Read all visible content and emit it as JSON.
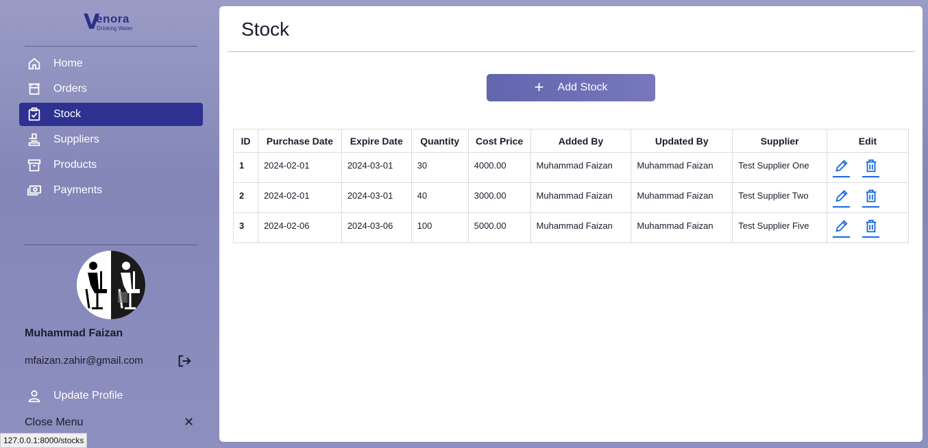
{
  "brand": {
    "logo_letter": "V",
    "logo_word": "enora",
    "logo_sub": "Drinking Water"
  },
  "sidebar": {
    "items": [
      {
        "label": "Home",
        "icon": "home-icon"
      },
      {
        "label": "Orders",
        "icon": "cart-icon"
      },
      {
        "label": "Stock",
        "icon": "clipboard-check-icon",
        "active": true
      },
      {
        "label": "Suppliers",
        "icon": "supplier-icon"
      },
      {
        "label": "Products",
        "icon": "archive-icon"
      },
      {
        "label": "Payments",
        "icon": "cash-icon"
      }
    ],
    "user": {
      "name": "Muhammad Faizan",
      "email": "mfaizan.zahir@gmail.com"
    },
    "update_profile_label": "Update Profile",
    "close_menu_label": "Close Menu",
    "close_symbol": "✕"
  },
  "status_url": "127.0.0.1:8000/stocks",
  "main": {
    "title": "Stock",
    "add_button_label": "Add Stock",
    "add_button_symbol": "+",
    "table": {
      "headers": [
        "ID",
        "Purchase Date",
        "Expire Date",
        "Quantity",
        "Cost Price",
        "Added By",
        "Updated By",
        "Supplier",
        "Edit"
      ],
      "rows": [
        [
          "1",
          "2024-02-01",
          "2024-03-01",
          "30",
          "4000.00",
          "Muhammad Faizan",
          "Muhammad Faizan",
          "Test Supplier One"
        ],
        [
          "2",
          "2024-02-01",
          "2024-03-01",
          "40",
          "3000.00",
          "Muhammad Faizan",
          "Muhammad Faizan",
          "Test Supplier Two"
        ],
        [
          "3",
          "2024-02-06",
          "2024-03-06",
          "100",
          "5000.00",
          "Muhammad Faizan",
          "Muhammad Faizan",
          "Test Supplier Five"
        ]
      ]
    }
  },
  "colors": {
    "accent": "#2e3190",
    "action": "#1a66e0",
    "button": "#6767b0"
  }
}
